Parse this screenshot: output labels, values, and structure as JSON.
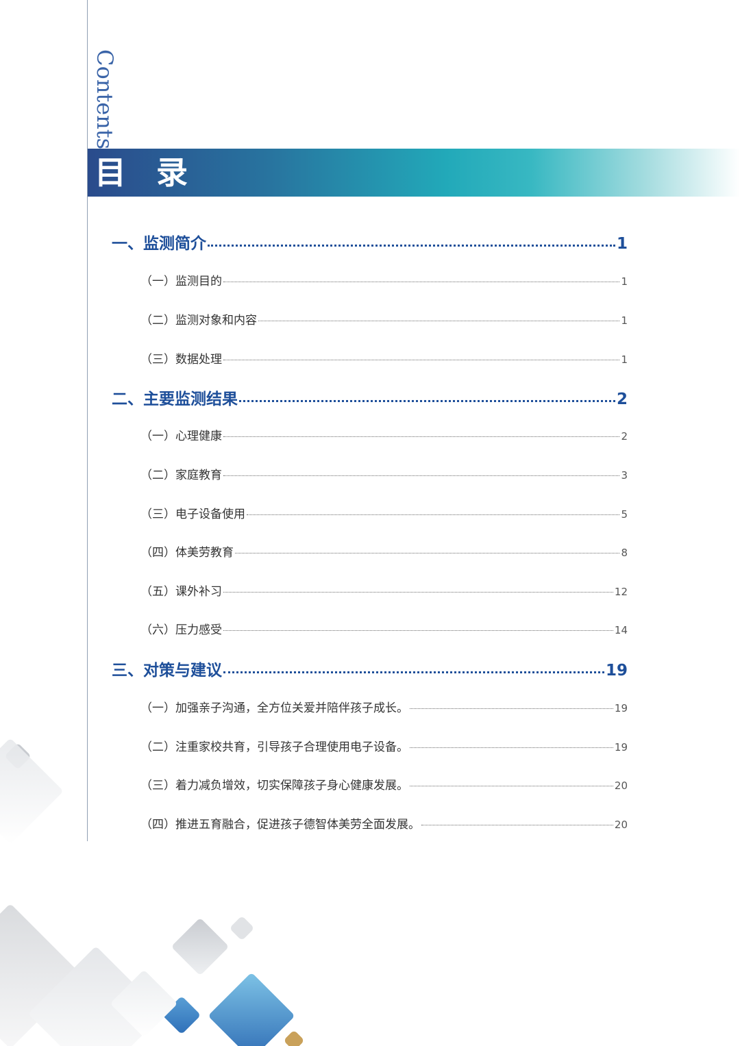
{
  "side_label": "Contents",
  "banner_title": "目录",
  "toc": [
    {
      "level": 1,
      "text": "一、监测简介",
      "page": "1"
    },
    {
      "level": 2,
      "text": "（一）监测目的",
      "page": "1"
    },
    {
      "level": 2,
      "text": "（二）监测对象和内容",
      "page": "1"
    },
    {
      "level": 2,
      "text": "（三）数据处理",
      "page": "1"
    },
    {
      "level": 1,
      "text": "二、主要监测结果",
      "page": "2"
    },
    {
      "level": 2,
      "text": "（一）心理健康",
      "page": "2"
    },
    {
      "level": 2,
      "text": "（二）家庭教育",
      "page": "3"
    },
    {
      "level": 2,
      "text": "（三）电子设备使用",
      "page": "5"
    },
    {
      "level": 2,
      "text": "（四）体美劳教育",
      "page": "8"
    },
    {
      "level": 2,
      "text": "（五）课外补习",
      "page": "12"
    },
    {
      "level": 2,
      "text": "（六）压力感受",
      "page": "14"
    },
    {
      "level": 1,
      "text": "三、对策与建议",
      "page": "19"
    },
    {
      "level": 2,
      "text": "（一）加强亲子沟通，全方位关爱并陪伴孩子成长。",
      "page": "19"
    },
    {
      "level": 2,
      "text": "（二）注重家校共育，引导孩子合理使用电子设备。",
      "page": "19"
    },
    {
      "level": 2,
      "text": "（三）着力减负增效，切实保障孩子身心健康发展。",
      "page": "20"
    },
    {
      "level": 2,
      "text": "（四）推进五育融合，促进孩子德智体美劳全面发展。",
      "page": "20"
    }
  ],
  "colors": {
    "heading_blue": "#1e4f9a",
    "banner_start": "#2a4b8c",
    "banner_mid": "#22a9b9",
    "side_label": "#3a64a8"
  }
}
